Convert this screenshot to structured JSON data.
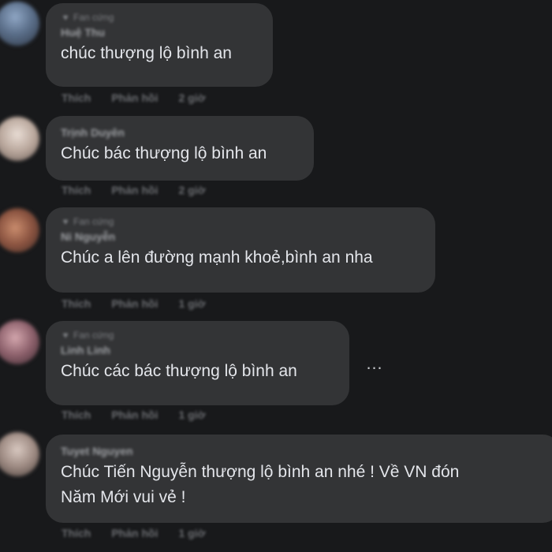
{
  "comments": [
    {
      "badge": "Fan cứng",
      "author": "Huệ Thu",
      "text_lines": [
        "chúc thượng lộ bình an"
      ],
      "like_label": "Thích",
      "reply_label": "Phản hồi",
      "time": "2 giờ"
    },
    {
      "author": "Trịnh Duyên",
      "text_lines": [
        "Chúc bác thượng lộ bình an"
      ],
      "like_label": "Thích",
      "reply_label": "Phản hồi",
      "time": "2 giờ"
    },
    {
      "badge": "Fan cứng",
      "author": "Ni Nguyễn",
      "text_lines": [
        "Chúc a lên đường mạnh khoẻ,bình an nha"
      ],
      "like_label": "Thích",
      "reply_label": "Phản hồi",
      "time": "1 giờ"
    },
    {
      "badge": "Fan cứng",
      "author": "Linh Linh",
      "text_lines": [
        "Chúc các bác thượng lộ bình an"
      ],
      "like_label": "Thích",
      "reply_label": "Phản hồi",
      "time": "1 giờ"
    },
    {
      "author": "Tuyet Nguyen",
      "text_lines": [
        "Chúc Tiến Nguyễn thượng lộ bình an nhé ! Về VN đón",
        "Năm Mới vui vẻ !"
      ],
      "like_label": "Thích",
      "reply_label": "Phản hồi",
      "time": "1 giờ"
    }
  ],
  "more_icon": "…",
  "badge_icon": "♥",
  "colors": {
    "background": "#18191b",
    "bubble": "#333436",
    "text": "#e4e6eb"
  }
}
